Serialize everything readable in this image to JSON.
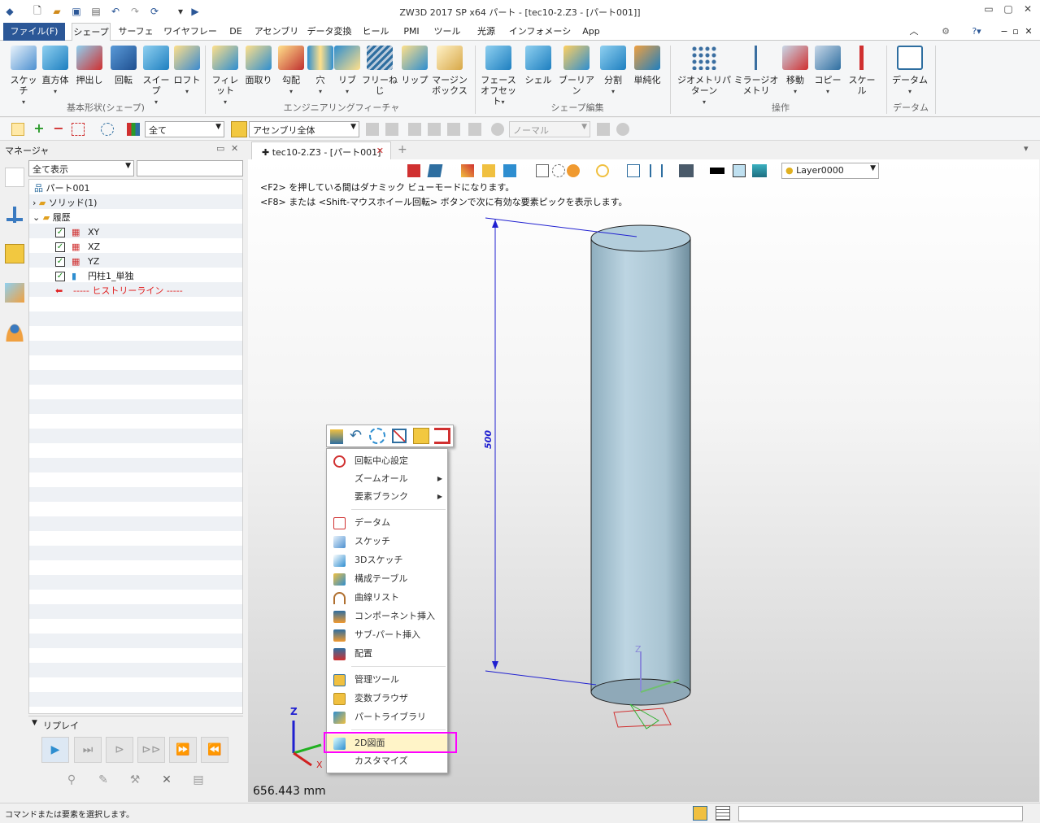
{
  "title": "ZW3D 2017 SP x64        パート - [tec10-2.Z3 - [パート001]]",
  "tabs": [
    "ファイル(F)",
    "シェープ",
    "サーフェス",
    "ワイヤフレーム",
    "DE",
    "アセンブリ",
    "データ変換",
    "ヒール",
    "PMI",
    "ツール",
    "光源",
    "インフォメーション",
    "App"
  ],
  "ribbon": {
    "basic": [
      "スケッチ",
      "直方体",
      "押出し",
      "回転",
      "スイープ",
      "ロフト"
    ],
    "basic_label": "基本形状(シェープ)",
    "eng": [
      "フィレット",
      "面取り",
      "勾配",
      "穴",
      "リブ",
      "フリーねじ",
      "リップ",
      "マージン",
      "ボックス"
    ],
    "eng_label": "エンジニアリングフィーチャ",
    "edit": [
      "フェース",
      "オフセット",
      "シェル",
      "ブーリアン",
      "分割",
      "単純化"
    ],
    "edit_label": "シェープ編集",
    "ops": [
      "ジオメトリパターン",
      "ミラージオメトリ",
      "移動",
      "コピー",
      "スケール"
    ],
    "ops_label": "操作",
    "datum": [
      "データム"
    ],
    "datum_label": "データム"
  },
  "toolbar": {
    "filter": "全て",
    "scope": "アセンブリ全体",
    "normal": "ノーマル"
  },
  "manager": {
    "title": "マネージャ",
    "filter": "全て表示",
    "tree": [
      {
        "label": "パート001"
      },
      {
        "label": "ソリッド(1)"
      },
      {
        "label": "履歴"
      },
      {
        "label": "XY"
      },
      {
        "label": "XZ"
      },
      {
        "label": "YZ"
      },
      {
        "label": "円柱1_単独"
      },
      {
        "label": "----- ヒストリーライン -----"
      }
    ],
    "replay": "リプレイ"
  },
  "doc": {
    "tab": "tec10-2.Z3 - [パート001]",
    "layer": "Layer0000"
  },
  "hints": [
    "<F2> を押している間はダナミック ビューモードになります。",
    "<F8> または <Shift-マウスホイール回転> ボタンで次に有効な要素ピックを表示します。"
  ],
  "dimension": "500",
  "measure": "656.443 mm",
  "menu": [
    "回転中心設定",
    "ズームオール",
    "要素ブランク",
    "データム",
    "スケッチ",
    "3Dスケッチ",
    "構成テーブル",
    "曲線リスト",
    "コンポーネント挿入",
    "サブ-パート挿入",
    "配置",
    "管理ツール",
    "変数ブラウザ",
    "パートライブラリ",
    "2D図面",
    "カスタマイズ"
  ],
  "status": "コマンドまたは要素を選択します。",
  "colors": {
    "accent": "#2b5797",
    "highlight": "#ff00ff",
    "cylinder": "#a9c4d2"
  }
}
